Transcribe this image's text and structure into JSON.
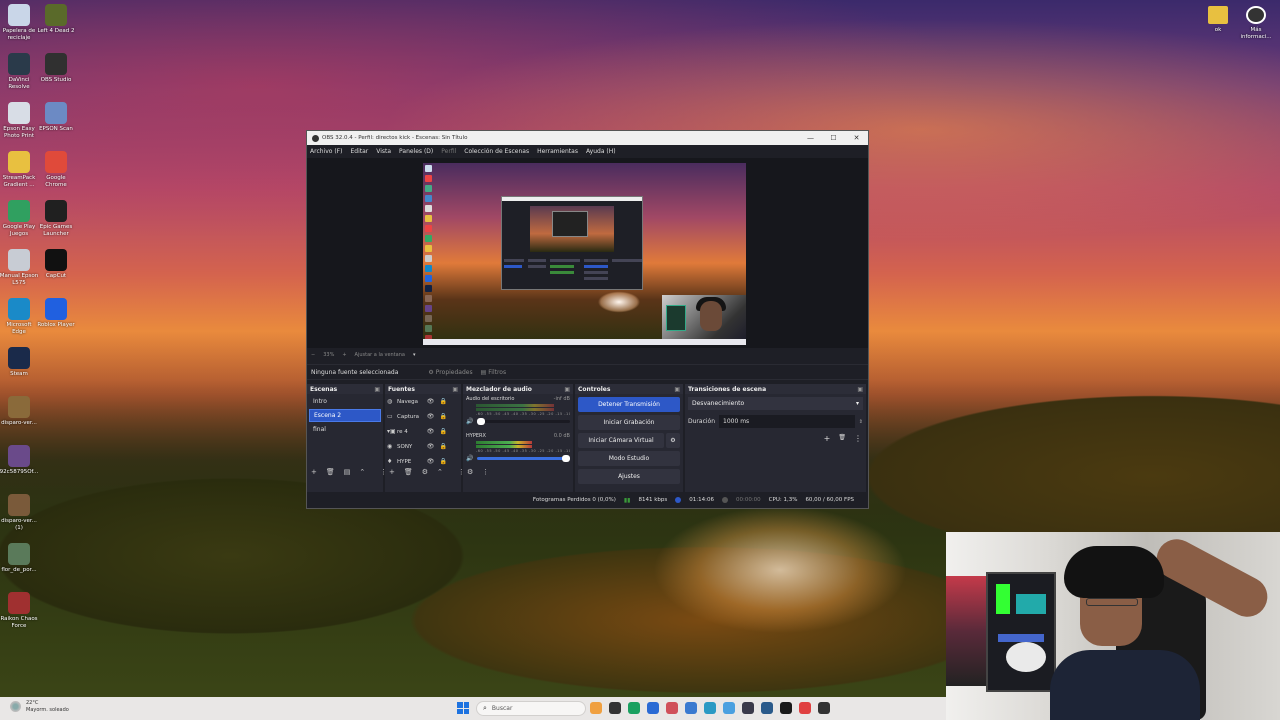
{
  "desktop": {
    "icons_left": [
      {
        "label": "Papelera de reciclaje",
        "color": "#c9d6e8"
      },
      {
        "label": "Left 4 Dead 2",
        "color": "#5a6a2a"
      },
      {
        "label": "DaVinci Resolve",
        "color": "#2a3a4a"
      },
      {
        "label": "OBS Studio",
        "color": "#303030"
      },
      {
        "label": "Epson Easy Photo Print",
        "color": "#d8dde6"
      },
      {
        "label": "EPSON Scan",
        "color": "#6c8ac4"
      },
      {
        "label": "StreamPack Gradient ...",
        "color": "#e8c040"
      },
      {
        "label": "Google Chrome",
        "color": "#e04a3a"
      },
      {
        "label": "Google Play Juegos",
        "color": "#30a060"
      },
      {
        "label": "Epic Games Launcher",
        "color": "#202020"
      },
      {
        "label": "Manual Epson L575",
        "color": "#c8ccd4"
      },
      {
        "label": "CapCut",
        "color": "#111111"
      },
      {
        "label": "Microsoft Edge",
        "color": "#1a8ac8"
      },
      {
        "label": "Roblox Player",
        "color": "#2060e0"
      },
      {
        "label": "Steam",
        "color": "#1a2a4a"
      },
      {
        "label": "disparo-ver...",
        "color": "#8a6a3a"
      },
      {
        "label": "92c58795Of...",
        "color": "#6a4a8a"
      },
      {
        "label": "disparo-ver... (1)",
        "color": "#7a5a3a"
      },
      {
        "label": "flor_de_por...",
        "color": "#5a7a5a"
      },
      {
        "label": "Raikon Chaos Force",
        "color": "#a03030"
      }
    ],
    "icons_right": [
      {
        "label": "ok",
        "color": "#e8c040"
      },
      {
        "label": "Más informaci...",
        "color": "#333333"
      }
    ]
  },
  "obs": {
    "title": "OBS 32.0.4 - Perfil: directos kick - Escenas: Sin Título",
    "window_controls": {
      "min": "—",
      "max": "☐",
      "close": "✕"
    },
    "menu": [
      "Archivo (F)",
      "Editar",
      "Vista",
      "Paneles (D)",
      "Perfil",
      "Colección de Escenas",
      "Herramientas",
      "Ayuda (H)"
    ],
    "zoom": {
      "minus": "−",
      "value": "33%",
      "plus": "+",
      "fit": "Ajustar a la ventana",
      "caret": "▾"
    },
    "source_bar": {
      "selected": "Ninguna fuente seleccionada",
      "properties": "Propiedades",
      "filters": "Filtros"
    },
    "scenes": {
      "title": "Escenas",
      "items": [
        "Intro",
        "Escena 2",
        "final"
      ],
      "selected_index": 1
    },
    "sources": {
      "title": "Fuentes",
      "items": [
        {
          "label": "Navega",
          "icon": "browser-icon"
        },
        {
          "label": "Captura",
          "icon": "display-icon"
        },
        {
          "label": "re 4",
          "icon": "folder-icon"
        },
        {
          "label": "SONY",
          "icon": "camera-icon"
        },
        {
          "label": "HYPE",
          "icon": "mic-icon"
        }
      ]
    },
    "mixer": {
      "title": "Mezclador de audio",
      "tracks": [
        {
          "name": "Audio del escritorio",
          "db": "-inf dB",
          "level": 0.0,
          "volume": 0.05
        },
        {
          "name": "HYPERX",
          "db": "0.0 dB",
          "level": 0.6,
          "volume": 1.0
        }
      ],
      "scale": "-60 -55 -50 -45 -40 -35 -30 -25 -20 -15 -10 -5 0"
    },
    "controls": {
      "title": "Controles",
      "stop_stream": "Detener Transmisión",
      "start_record": "Iniciar Grabación",
      "virtual_cam": "Iniciar Cámara Virtual",
      "studio_mode": "Modo Estudio",
      "settings": "Ajustes"
    },
    "transitions": {
      "title": "Transiciones de escena",
      "selected": "Desvanecimiento",
      "duration_label": "Duración",
      "duration_value": "1000 ms"
    },
    "status": {
      "dropped": "Fotogramas Perdidos 0 (0,0%)",
      "bitrate": "8141 kbps",
      "live_time": "01:14:06",
      "rec_time": "00:00:00",
      "cpu": "CPU: 1,3%",
      "fps": "60,00 / 60,00 FPS",
      "colors": {
        "live": "#2d58c7",
        "bitrate": "#3a9a3a",
        "rec": "#555555"
      }
    }
  },
  "taskbar": {
    "weather_temp": "22°C",
    "weather_text": "Mayorm. soleado",
    "search_placeholder": "Buscar",
    "apps": [
      "#f0a040",
      "#333333",
      "#1aa060",
      "#2a6ad4",
      "#d0505a",
      "#3a7ad0",
      "#2a9ac4",
      "#4aa0e0",
      "#3a3a4a",
      "#2a5a8a",
      "#1a1a1a",
      "#e04040",
      "#333333"
    ]
  }
}
